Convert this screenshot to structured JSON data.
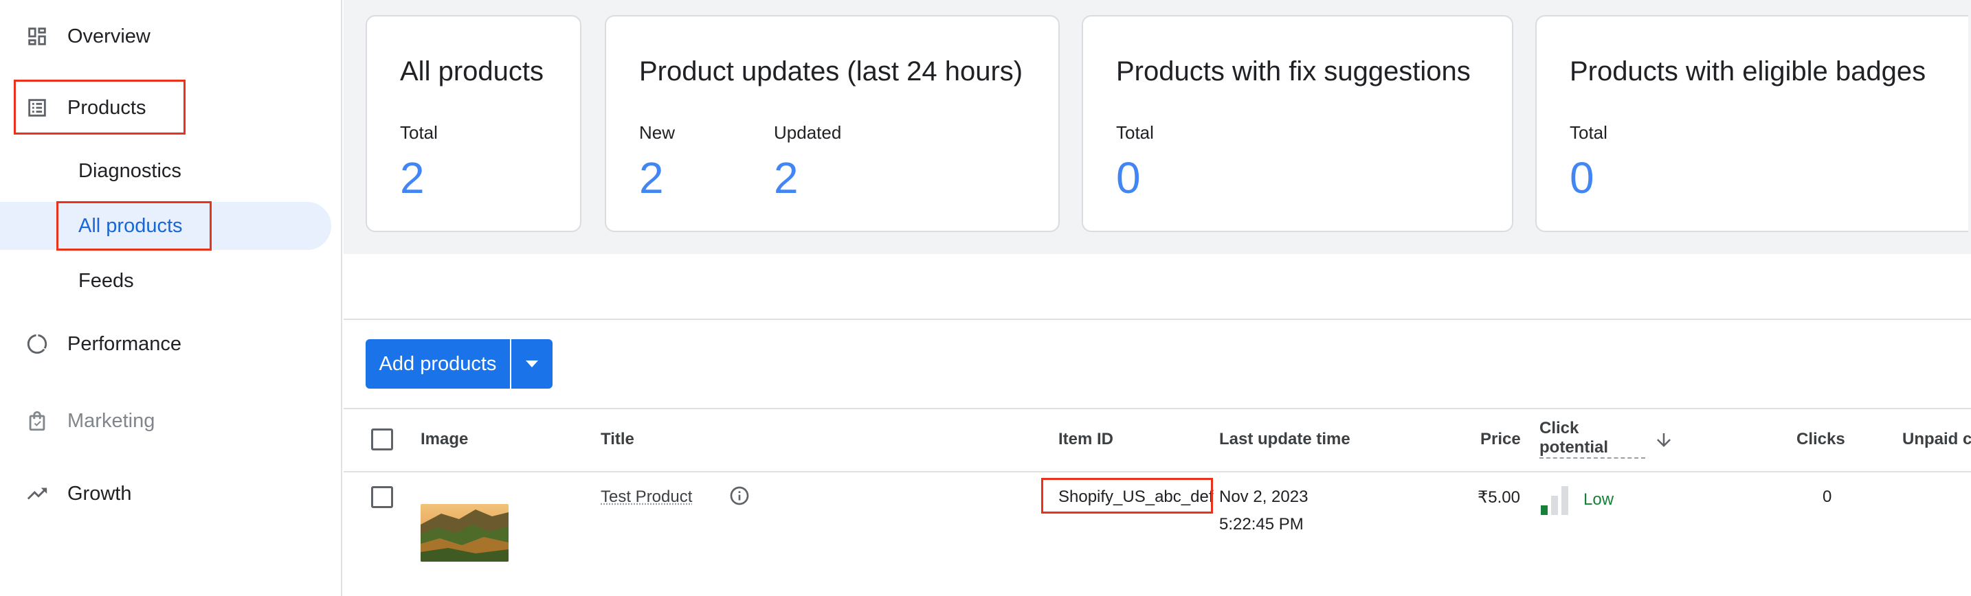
{
  "sidebar": {
    "items": [
      {
        "label": "Overview",
        "icon": "dashboard-icon"
      },
      {
        "label": "Products",
        "icon": "list-icon"
      },
      {
        "label": "Performance",
        "icon": "performance-icon"
      },
      {
        "label": "Marketing",
        "icon": "shopping-bag-icon"
      },
      {
        "label": "Growth",
        "icon": "trending-up-icon"
      }
    ],
    "sub_items": [
      {
        "label": "Diagnostics"
      },
      {
        "label": "All products"
      },
      {
        "label": "Feeds"
      }
    ]
  },
  "stats": {
    "cards": [
      {
        "title": "All products",
        "stats": [
          {
            "label": "Total",
            "value": "2"
          }
        ]
      },
      {
        "title": "Product updates (last 24 hours)",
        "stats": [
          {
            "label": "New",
            "value": "2"
          },
          {
            "label": "Updated",
            "value": "2"
          }
        ]
      },
      {
        "title": "Products with fix suggestions",
        "stats": [
          {
            "label": "Total",
            "value": "0"
          }
        ]
      },
      {
        "title": "Products with eligible badges",
        "stats": [
          {
            "label": "Total",
            "value": "0"
          }
        ]
      }
    ]
  },
  "actions": {
    "add_products_label": "Add products"
  },
  "table": {
    "columns": {
      "image": "Image",
      "title": "Title",
      "item_id": "Item ID",
      "last_update_time": "Last update time",
      "price": "Price",
      "click_potential_line1": "Click",
      "click_potential_line2": "potential",
      "clicks": "Clicks",
      "unpaid_clicks": "Unpaid cl"
    },
    "rows": [
      {
        "title": "Test Product",
        "item_id": "Shopify_US_abc_def",
        "last_update_date": "Nov 2, 2023",
        "last_update_time": "5:22:45 PM",
        "price": "₹5.00",
        "click_potential": "Low",
        "click_potential_level": 1,
        "click_potential_max": 3,
        "clicks": "0"
      }
    ]
  },
  "colors": {
    "accent": "#1a73e8",
    "stat_value": "#4285f4",
    "highlight_box": "#e8321a",
    "low_potential": "#188038"
  }
}
